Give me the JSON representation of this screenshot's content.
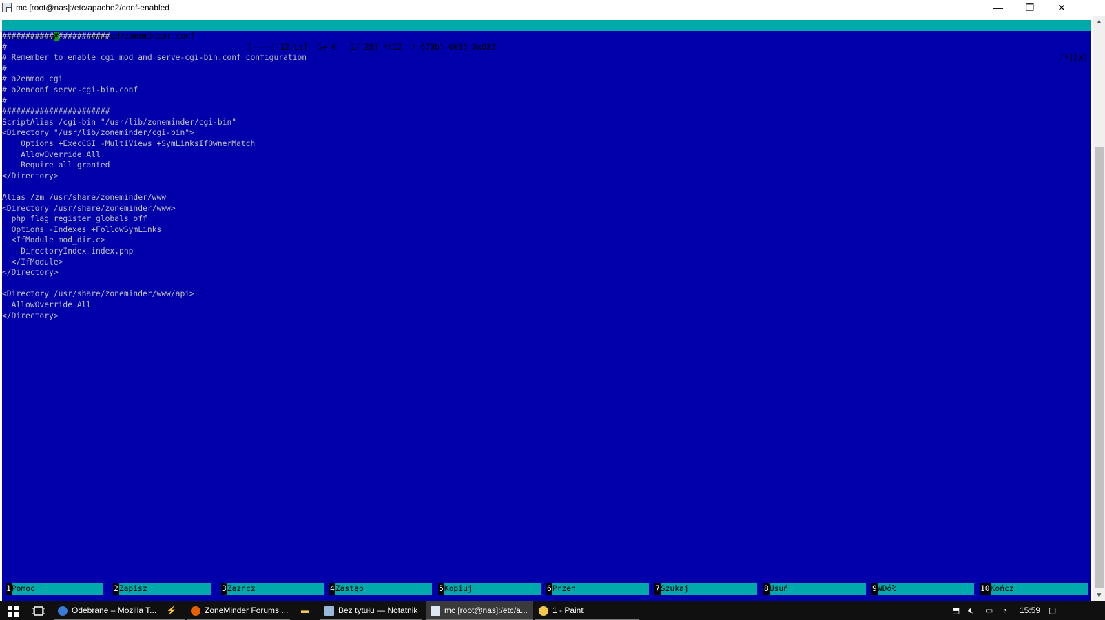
{
  "window": {
    "title": "mc [root@nas]:/etc/apache2/conf-enabled",
    "minimize": "—",
    "restore": "❐",
    "close": "✕"
  },
  "status": {
    "path": "/etc/apache2/conf-enabled/zoneminder.conf",
    "info": "[----] 12 L:[  1+ 0   1/ 28] *(12  / 670b) 0035 0x023",
    "controls": "[*][X]"
  },
  "editor": {
    "cursor_line_before": "###########",
    "cursor_char": "#",
    "cursor_line_after": "###########",
    "lines": [
      "#",
      "# Remember to enable cgi mod and serve-cgi-bin.conf configuration",
      "#",
      "# a2enmod cgi",
      "# a2enconf serve-cgi-bin.conf",
      "#",
      "#######################",
      "ScriptAlias /cgi-bin \"/usr/lib/zoneminder/cgi-bin\"",
      "<Directory \"/usr/lib/zoneminder/cgi-bin\">",
      "    Options +ExecCGI -MultiViews +SymLinksIfOwnerMatch",
      "    AllowOverride All",
      "    Require all granted",
      "</Directory>",
      "",
      "Alias /zm /usr/share/zoneminder/www",
      "<Directory /usr/share/zoneminder/www>",
      "  php_flag register_globals off",
      "  Options -Indexes +FollowSymLinks",
      "  <IfModule mod_dir.c>",
      "    DirectoryIndex index.php",
      "  </IfModule>",
      "</Directory>",
      "",
      "<Directory /usr/share/zoneminder/www/api>",
      "  AllowOverride All",
      "</Directory>"
    ]
  },
  "fkeys": [
    {
      "num": "1",
      "label": "Pomoc"
    },
    {
      "num": "2",
      "label": "Zapisz"
    },
    {
      "num": "3",
      "label": "Zazncz"
    },
    {
      "num": "4",
      "label": "Zastąp"
    },
    {
      "num": "5",
      "label": "Kopiuj"
    },
    {
      "num": "6",
      "label": "Przen"
    },
    {
      "num": "7",
      "label": "Szukaj"
    },
    {
      "num": "8",
      "label": "Usuń"
    },
    {
      "num": "9",
      "label": "WDół"
    },
    {
      "num": "10",
      "label": "Kończ"
    }
  ],
  "taskbar": {
    "tasks": [
      {
        "label": "Odebrane – Mozilla T...",
        "color": "#3a7bd5"
      },
      {
        "label": "ZoneMinder Forums ...",
        "color": "#e66000"
      },
      {
        "label": "Bez tytułu — Notatnik",
        "color": "#9ab8d8"
      },
      {
        "label": "mc [root@nas]:/etc/a...",
        "color": "#dfe7f3"
      },
      {
        "label": "1 - Paint",
        "color": "#f2c94c"
      }
    ],
    "clock": "15:59"
  },
  "colors": {
    "terminal_bg": "#0000aa",
    "status_bg": "#00aaaa",
    "cursor_bg": "#00aa00",
    "text": "#c0c0c0"
  }
}
